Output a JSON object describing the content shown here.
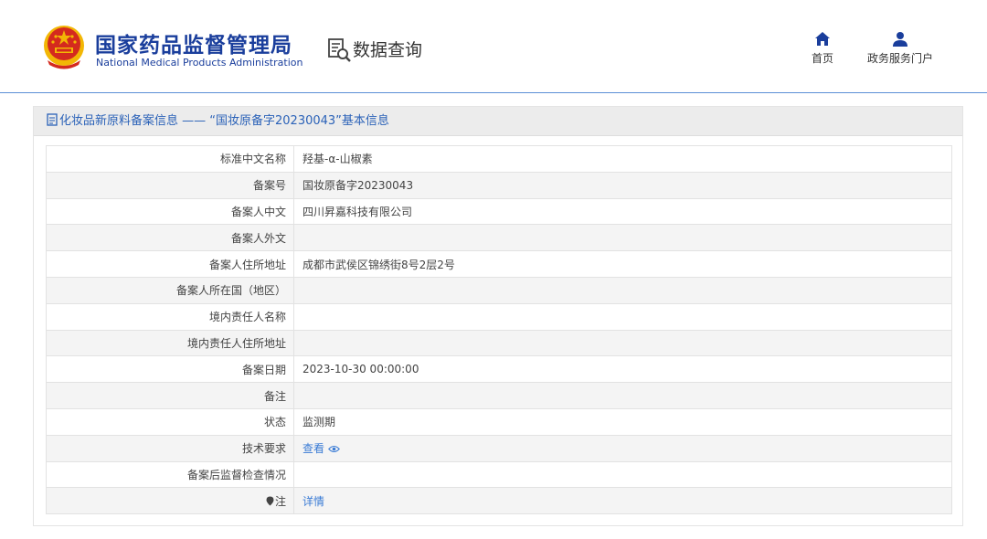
{
  "header": {
    "brand_cn": "国家药品监督管理局",
    "brand_en": "National Medical Products Administration",
    "query_label": "数据查询",
    "nav": [
      {
        "label": "首页",
        "icon": "home-icon"
      },
      {
        "label": "政务服务门户",
        "icon": "user-icon"
      }
    ]
  },
  "panel": {
    "title": "化妆品新原料备案信息 —— “国妆原备字20230043”基本信息"
  },
  "rows": [
    {
      "label": "标准中文名称",
      "value": "羟基-α-山椒素"
    },
    {
      "label": "备案号",
      "value": "国妆原备字20230043"
    },
    {
      "label": "备案人中文",
      "value": "四川昇嘉科技有限公司"
    },
    {
      "label": "备案人外文",
      "value": ""
    },
    {
      "label": "备案人住所地址",
      "value": "成都市武侯区锦绣街8号2层2号"
    },
    {
      "label": "备案人所在国（地区）",
      "value": ""
    },
    {
      "label": "境内责任人名称",
      "value": ""
    },
    {
      "label": "境内责任人住所地址",
      "value": ""
    },
    {
      "label": "备案日期",
      "value": "2023-10-30 00:00:00"
    },
    {
      "label": "备注",
      "value": ""
    },
    {
      "label": "状态",
      "value": "监测期"
    },
    {
      "label": "技术要求",
      "value": "查看"
    },
    {
      "label": "备案后监督检查情况",
      "value": ""
    },
    {
      "label": "注",
      "value": "详情"
    }
  ],
  "colors": {
    "brand": "#1a3e9c",
    "link": "#3a7bd5",
    "header_rule": "#5b8fd6",
    "emblem_red": "#d42a1e",
    "emblem_gold": "#f2b705"
  }
}
